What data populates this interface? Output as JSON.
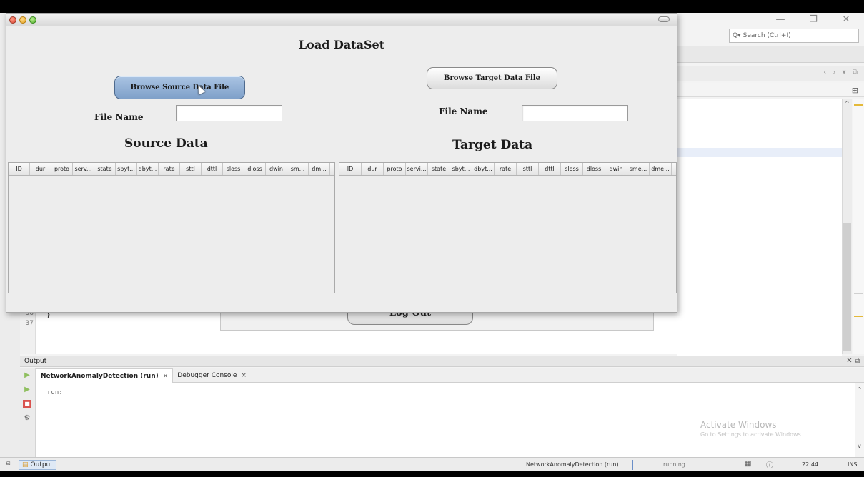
{
  "ide": {
    "search_placeholder": "Search (Ctrl+I)",
    "search_icon": "magnifier-dropdown-icon",
    "editor_lines": [
      "36",
      "37"
    ],
    "code_char": "}",
    "logout_label": "Log Out",
    "output_header": "Output",
    "output_tabs": [
      {
        "label": "NetworkAnomalyDetection (run)",
        "close": "×"
      },
      {
        "label": "Debugger Console",
        "close": "×"
      }
    ],
    "output_text": "run:",
    "watermark_title": "Activate Windows",
    "watermark_sub": "Go to Settings to activate Windows.",
    "status": {
      "output_label": "Output",
      "process": "NetworkAnomalyDetection (run)",
      "running": "running...",
      "time": "22:44",
      "mode": "INS"
    }
  },
  "dialog": {
    "title": "Load DataSet",
    "source_button": "Browse Source Data File",
    "target_button": "Browse Target Data File",
    "file_name_label": "File Name",
    "file_name_source_value": "",
    "file_name_target_value": "",
    "source_title": "Source Data",
    "target_title": "Target Data",
    "source_columns": [
      "ID",
      "dur",
      "proto",
      "serv...",
      "state",
      "sbyt...",
      "dbyt...",
      "rate",
      "sttl",
      "dttl",
      "sloss",
      "dloss",
      "dwin",
      "sm...",
      "dm..."
    ],
    "target_columns": [
      "ID",
      "dur",
      "proto",
      "servi...",
      "state",
      "sbyt...",
      "dbyt...",
      "rate",
      "sttl",
      "dttl",
      "sloss",
      "dloss",
      "dwin",
      "sme...",
      "dme..."
    ]
  }
}
